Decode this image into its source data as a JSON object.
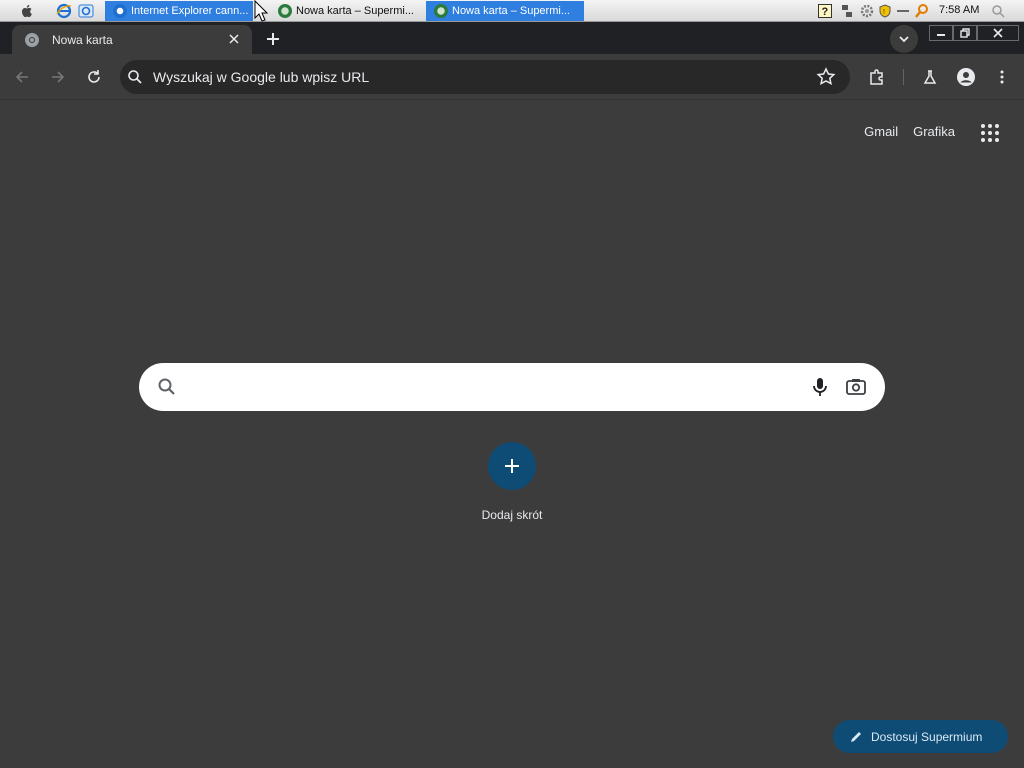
{
  "taskbar": {
    "tasks": [
      {
        "label": "Internet Explorer cann...",
        "active": true
      },
      {
        "label": "Nowa karta – Supermi...",
        "active": false
      },
      {
        "label": "Nowa karta – Supermi...",
        "active": true
      }
    ],
    "clock": "7:58 AM",
    "tray_icons": [
      "help-icon",
      "network-icon",
      "gear-icon",
      "shield-icon",
      "key-icon",
      "magnifier-icon"
    ]
  },
  "browser": {
    "tab": {
      "title": "Nowa karta"
    },
    "omnibox": {
      "placeholder": "Wyszukaj w Google lub wpisz URL"
    },
    "colors": {
      "background": "#3c3c3c",
      "tabstrip": "#202124",
      "accent": "#0f4c75"
    }
  },
  "ntp": {
    "links": [
      "Gmail",
      "Grafika"
    ],
    "search": {
      "value": ""
    },
    "shortcut": {
      "label": "Dodaj skrót"
    },
    "customize": {
      "label": "Dostosuj Supermium"
    }
  }
}
